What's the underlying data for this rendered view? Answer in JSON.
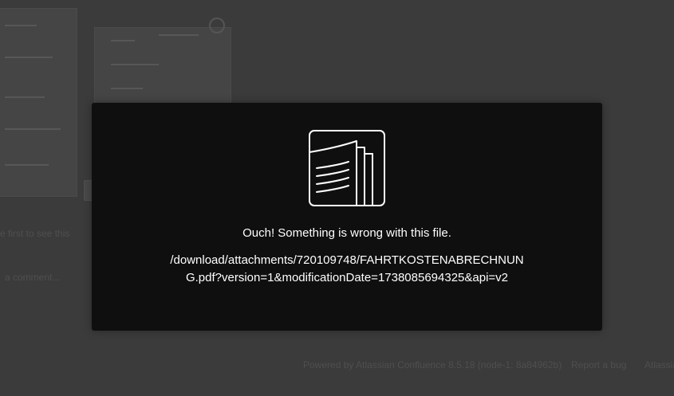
{
  "background": {
    "hint_text": "e first to see this",
    "comment_placeholder": "a comment...",
    "footer_powered": "Powered by Atlassian Confluence 8.5.18 (node-1: 8a84962b)",
    "footer_report": "Report a bug",
    "footer_news": "Atlassian News"
  },
  "modal": {
    "icon": "document-pages-icon",
    "error_title": "Ouch! Something is wrong with this file.",
    "error_path": "/download/attachments/720109748/FAHRTKOSTENABRECHNUNG.pdf?version=1&modificationDate=1738085694325&api=v2"
  },
  "colors": {
    "backdrop": "#3b3b3b",
    "modal_bg": "#0f0f0f",
    "text": "#ffffff"
  }
}
